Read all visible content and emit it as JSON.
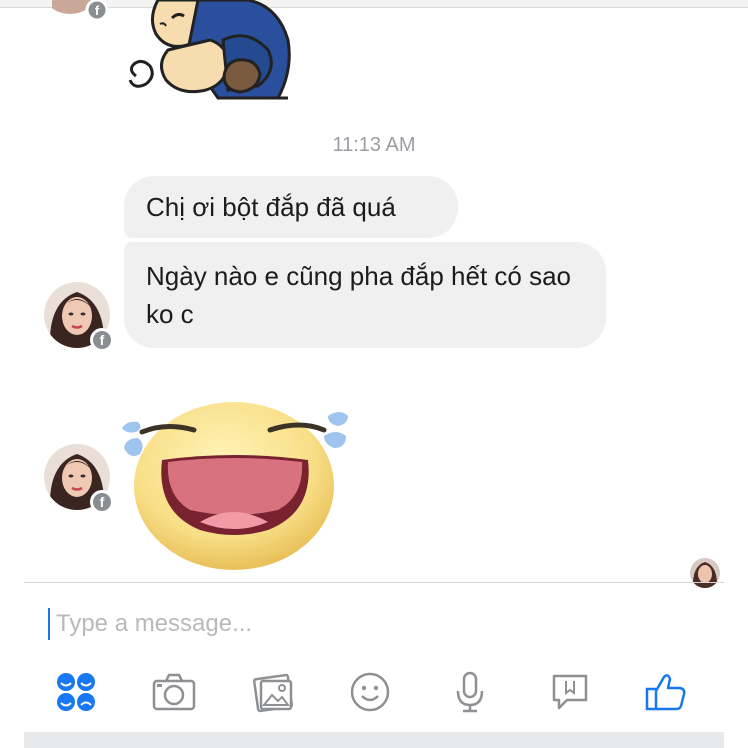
{
  "thread": {
    "timestamp": "11:13 AM",
    "messages": [
      {
        "text": "Chị ơi bột đắp đã quá"
      },
      {
        "text": "Ngày nào e cũng pha đắp hết có sao ko c"
      }
    ],
    "stickers": [
      "hug-sticker",
      "laughing-emoji-sticker"
    ]
  },
  "composer": {
    "placeholder": "Type a message..."
  },
  "toolbar": {
    "icons": [
      "apps-icon",
      "camera-icon",
      "gallery-icon",
      "emoji-icon",
      "microphone-icon",
      "like-sticker-icon",
      "thumbs-up-icon"
    ]
  },
  "colors": {
    "accent": "#1877f2",
    "bubble": "#f1f0f0",
    "timestamp": "#9c9ea3",
    "icon_gray": "#8e9094"
  }
}
